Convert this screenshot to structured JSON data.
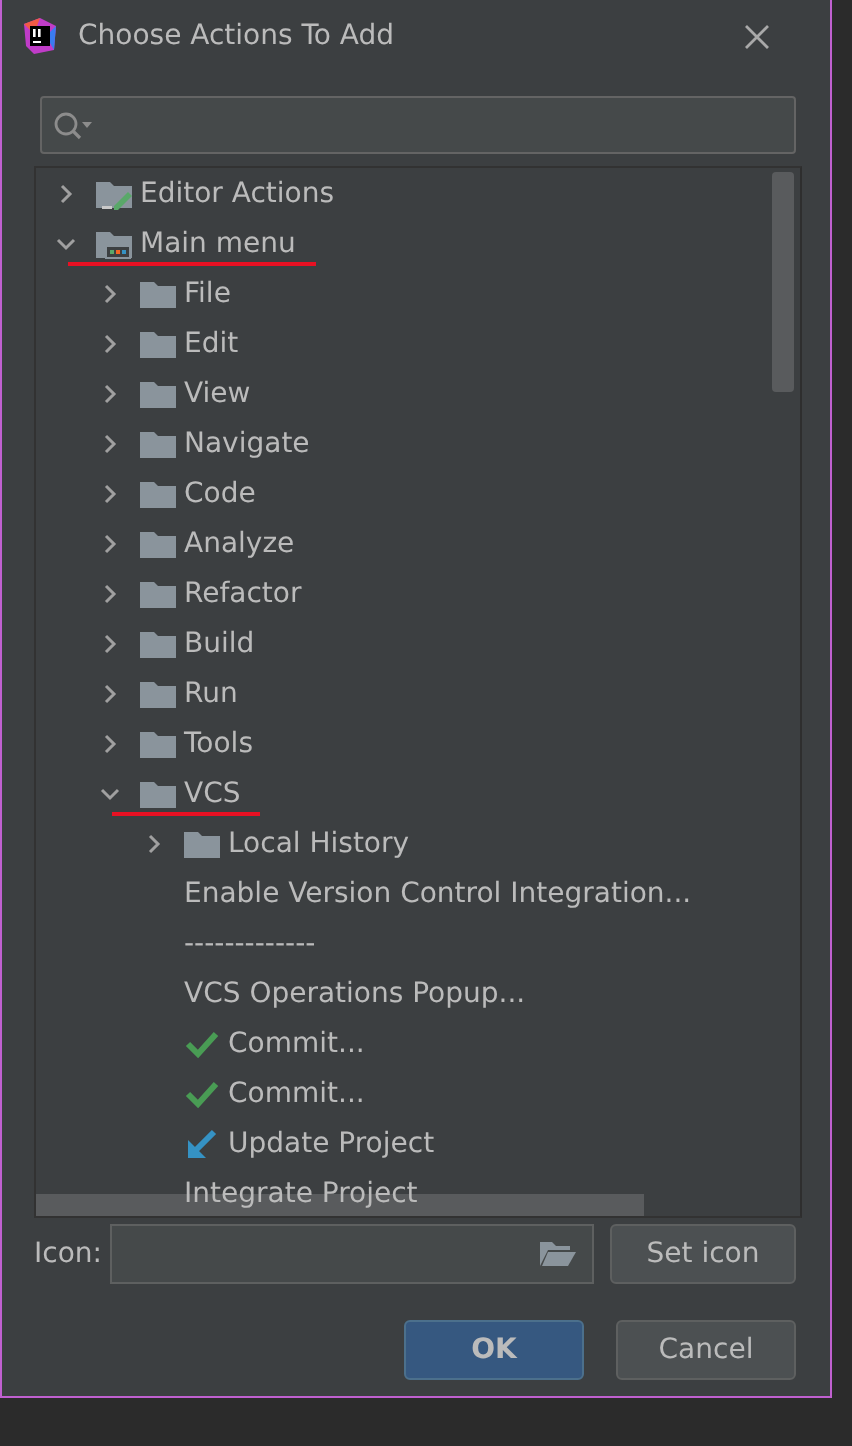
{
  "window": {
    "title": "Choose Actions To Add"
  },
  "tree": [
    {
      "label": "Editor Actions",
      "kind": "editor-folder",
      "expanded": false,
      "underlined": false
    },
    {
      "label": "Main menu",
      "kind": "menu-folder",
      "expanded": true,
      "underlined": true,
      "children": [
        {
          "label": "File",
          "kind": "folder",
          "expanded": false,
          "underlined": false
        },
        {
          "label": "Edit",
          "kind": "folder",
          "expanded": false,
          "underlined": false
        },
        {
          "label": "View",
          "kind": "folder",
          "expanded": false,
          "underlined": false
        },
        {
          "label": "Navigate",
          "kind": "folder",
          "expanded": false,
          "underlined": false
        },
        {
          "label": "Code",
          "kind": "folder",
          "expanded": false,
          "underlined": false
        },
        {
          "label": "Analyze",
          "kind": "folder",
          "expanded": false,
          "underlined": false
        },
        {
          "label": "Refactor",
          "kind": "folder",
          "expanded": false,
          "underlined": false
        },
        {
          "label": "Build",
          "kind": "folder",
          "expanded": false,
          "underlined": false
        },
        {
          "label": "Run",
          "kind": "folder",
          "expanded": false,
          "underlined": false
        },
        {
          "label": "Tools",
          "kind": "folder",
          "expanded": false,
          "underlined": false
        },
        {
          "label": "VCS",
          "kind": "folder",
          "expanded": true,
          "underlined": true,
          "children": [
            {
              "label": "Local History",
              "kind": "folder",
              "expanded": false,
              "underlined": false
            },
            {
              "label": "Enable Version Control Integration...",
              "kind": "action",
              "underlined": false
            },
            {
              "label": "-------------",
              "kind": "separator",
              "underlined": false
            },
            {
              "label": "VCS Operations Popup...",
              "kind": "action",
              "underlined": false
            },
            {
              "label": "Commit...",
              "kind": "check",
              "underlined": false
            },
            {
              "label": "Commit...",
              "kind": "check",
              "underlined": false
            },
            {
              "label": "Update Project",
              "kind": "update",
              "underlined": false
            },
            {
              "label": "Integrate Project",
              "kind": "action",
              "underlined": false
            }
          ]
        }
      ]
    }
  ],
  "icon_field": {
    "label": "Icon:"
  },
  "buttons": [
    {
      "label": "Set icon",
      "kind": "set-icon"
    },
    {
      "label": "OK",
      "kind": "default"
    },
    {
      "label": "Cancel",
      "kind": "normal"
    }
  ]
}
